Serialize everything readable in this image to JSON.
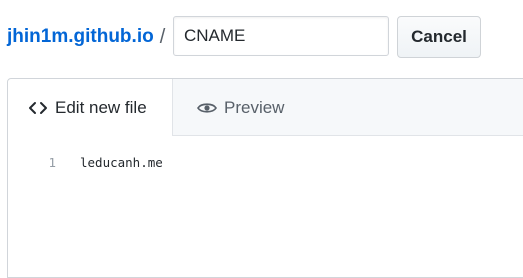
{
  "breadcrumb": {
    "repo": "jhin1m.github.io",
    "separator": "/"
  },
  "filename": {
    "value": "CNAME"
  },
  "cancel": {
    "label": "Cancel"
  },
  "tabs": [
    {
      "label": "Edit new file",
      "icon": "code-icon",
      "active": true
    },
    {
      "label": "Preview",
      "icon": "eye-icon",
      "active": false
    }
  ],
  "editor": {
    "lines": [
      {
        "number": "1",
        "text": "leducanh.me"
      }
    ]
  },
  "colors": {
    "link": "#0366d6",
    "border": "#d1d5da",
    "tabbar": "#f6f8fa"
  }
}
